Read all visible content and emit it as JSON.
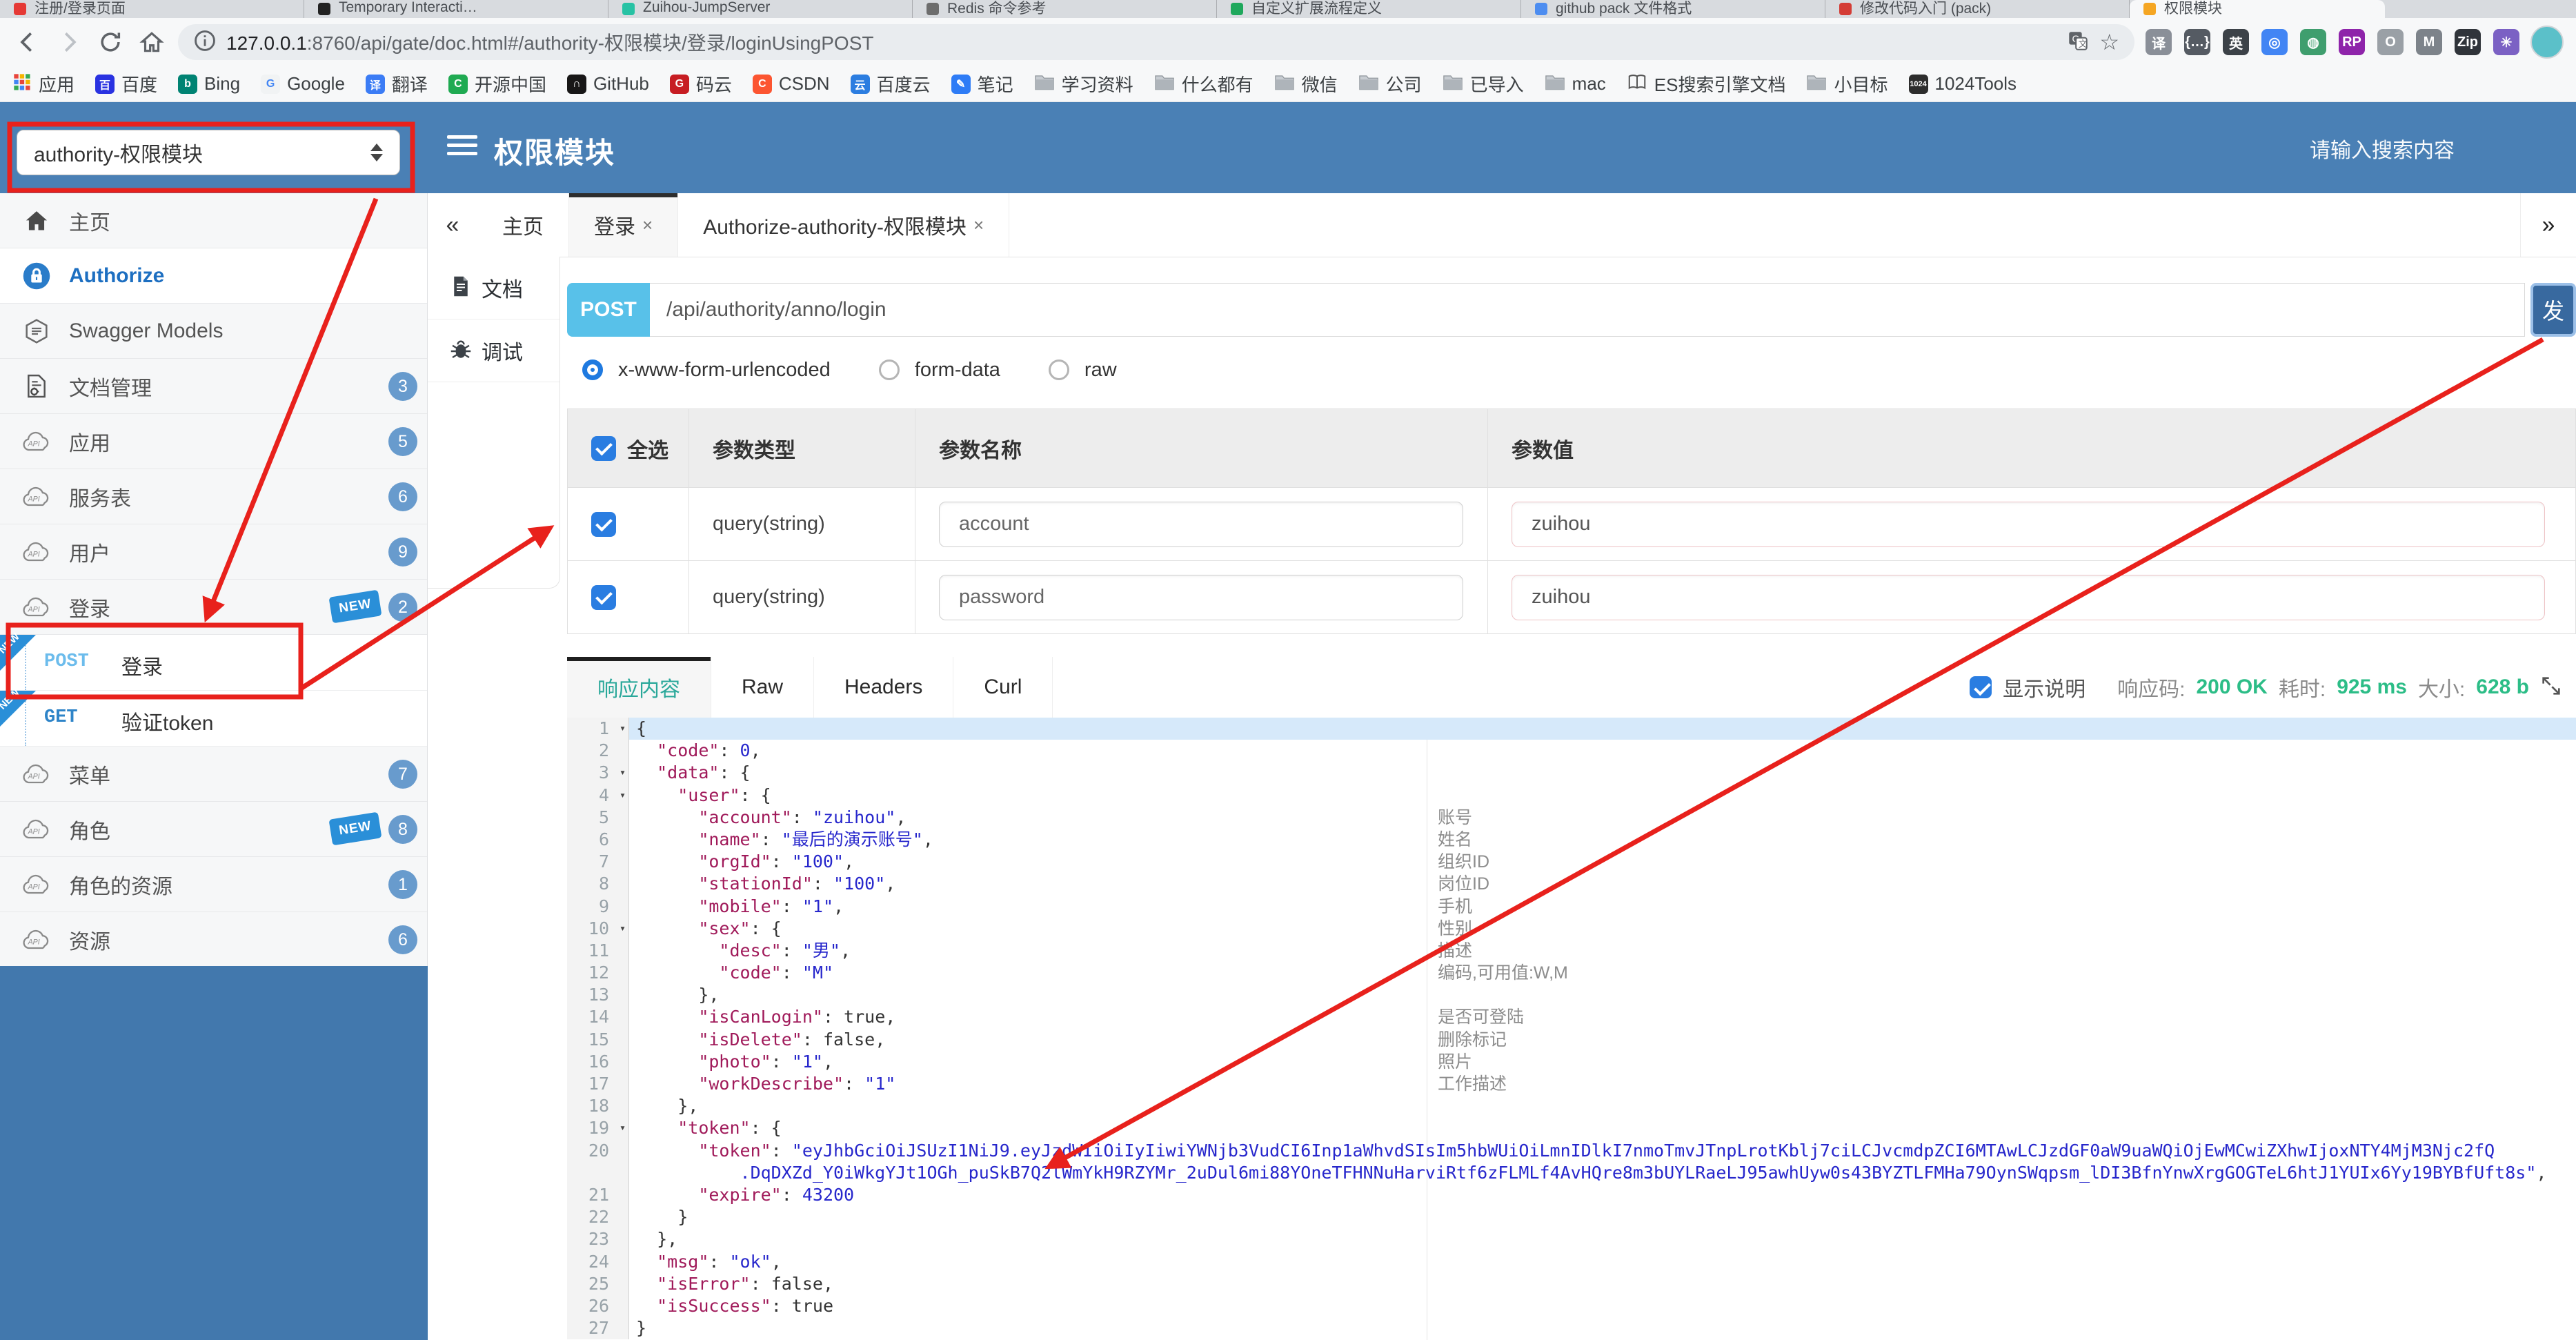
{
  "browser": {
    "tabs": [
      {
        "title": "注册/登录页面",
        "color": "#e53935"
      },
      {
        "title": "Temporary Interacti…",
        "color": "#222222"
      },
      {
        "title": "Zuihou-JumpServer",
        "color": "#27c2a4"
      },
      {
        "title": "Redis 命令参考",
        "color": "#6d6d6d"
      },
      {
        "title": "自定义扩展流程定义",
        "color": "#1fa85c"
      },
      {
        "title": "github pack 文件格式",
        "color": "#4d8df0"
      },
      {
        "title": "修改代码入门 (pack)",
        "color": "#d43c35"
      },
      {
        "title": "权限模块",
        "color": "#f5a623",
        "active": true
      }
    ],
    "url": {
      "host": "127.0.0.1",
      "rest": ":8760/api/gate/doc.html#/authority-权限模块/登录/loginUsingPOST"
    },
    "extensions": [
      {
        "name": "translate-ext-icon",
        "glyph": "译",
        "color": "#8a8f98"
      },
      {
        "name": "json-viewer-ext-icon",
        "glyph": "{…}",
        "color": "#555b63"
      },
      {
        "name": "en-translate-ext-icon",
        "glyph": "英",
        "color": "#3c4248"
      },
      {
        "name": "chrome-ext-icon",
        "glyph": "◎",
        "color": "#4285f4"
      },
      {
        "name": "proxy-globe-ext-icon",
        "glyph": "◍",
        "color": "#3f9e6e"
      },
      {
        "name": "rp-ext-icon",
        "glyph": "RP",
        "color": "#8e24aa"
      },
      {
        "name": "o-ext-icon",
        "glyph": "O",
        "color": "#9aa0a6"
      },
      {
        "name": "shield-ext-icon",
        "glyph": "M",
        "color": "#7d838a"
      },
      {
        "name": "gitzip-ext-icon",
        "glyph": "Zip",
        "color": "#30343a"
      },
      {
        "name": "pinwheel-ext-icon",
        "glyph": "✳",
        "color": "#7b61c4"
      }
    ],
    "bookmarks": [
      {
        "label": "应用",
        "icon": "grid"
      },
      {
        "label": "百度",
        "icon": "badge",
        "color": "#2932e1",
        "glyph": "百"
      },
      {
        "label": "Bing",
        "icon": "badge",
        "color": "#008373",
        "glyph": "b"
      },
      {
        "label": "Google",
        "icon": "badge",
        "color": "#f1f3f4",
        "glyph": "G",
        "glyphColor": "#4285f4"
      },
      {
        "label": "翻译",
        "icon": "badge",
        "color": "#3b7cf5",
        "glyph": "译"
      },
      {
        "label": "开源中国",
        "icon": "badge",
        "color": "#1faa52",
        "glyph": "C"
      },
      {
        "label": "GitHub",
        "icon": "badge",
        "color": "#181717",
        "glyph": "∩"
      },
      {
        "label": "码云",
        "icon": "badge",
        "color": "#c71d23",
        "glyph": "G"
      },
      {
        "label": "CSDN",
        "icon": "badge",
        "color": "#fc5531",
        "glyph": "C"
      },
      {
        "label": "百度云",
        "icon": "badge",
        "color": "#2b7de0",
        "glyph": "云"
      },
      {
        "label": "笔记",
        "icon": "badge",
        "color": "#2e7cf6",
        "glyph": "✎"
      },
      {
        "label": "学习资料",
        "icon": "folder"
      },
      {
        "label": "什么都有",
        "icon": "folder"
      },
      {
        "label": "微信",
        "icon": "folder"
      },
      {
        "label": "公司",
        "icon": "folder"
      },
      {
        "label": "已导入",
        "icon": "folder"
      },
      {
        "label": "mac",
        "icon": "folder"
      },
      {
        "label": "ES搜索引擎文档",
        "icon": "book"
      },
      {
        "label": "小目标",
        "icon": "folder"
      },
      {
        "label": "1024Tools",
        "icon": "badge",
        "color": "#2d2d2d",
        "glyph": "1024"
      }
    ]
  },
  "header": {
    "module_select": "authority-权限模块",
    "title": "权限模块",
    "search_placeholder": "请输入搜索内容"
  },
  "sidebar": {
    "items": [
      {
        "icon": "home",
        "label": "主页"
      },
      {
        "icon": "lock",
        "label": "Authorize",
        "auth": true
      },
      {
        "icon": "swagger",
        "label": "Swagger Models"
      },
      {
        "icon": "docmgr",
        "label": "文档管理",
        "badge": "3"
      },
      {
        "icon": "api",
        "label": "应用",
        "badge": "5"
      },
      {
        "icon": "api",
        "label": "服务表",
        "badge": "6"
      },
      {
        "icon": "api",
        "label": "用户",
        "badge": "9"
      },
      {
        "icon": "api",
        "label": "登录",
        "badge": "2",
        "isNew": true
      },
      {
        "endpoint": true,
        "method": "POST",
        "label": "登录",
        "ribbon": "NEW"
      },
      {
        "endpoint": true,
        "method": "GET",
        "label": "验证token",
        "ribbon": "NEW"
      },
      {
        "icon": "api",
        "label": "菜单",
        "badge": "7"
      },
      {
        "icon": "api",
        "label": "角色",
        "badge": "8",
        "isNew": true
      },
      {
        "icon": "api",
        "label": "角色的资源",
        "badge": "1"
      },
      {
        "icon": "api",
        "label": "资源",
        "badge": "6"
      }
    ],
    "new_label": "NEW"
  },
  "tabsbar": {
    "collapse": "«",
    "more": "»",
    "items": [
      {
        "label": "主页",
        "closable": false
      },
      {
        "label": "登录",
        "closable": true,
        "active": true
      },
      {
        "label": "Authorize-authority-权限模块",
        "closable": true
      }
    ],
    "close_glyph": "×"
  },
  "docnav": [
    {
      "icon": "doc",
      "label": "文档"
    },
    {
      "icon": "bug",
      "label": "调试",
      "active": true
    }
  ],
  "request": {
    "method": "POST",
    "url": "/api/authority/anno/login",
    "send_label": "发",
    "body_types": [
      {
        "label": "x-www-form-urlencoded",
        "selected": true
      },
      {
        "label": "form-data",
        "selected": false
      },
      {
        "label": "raw",
        "selected": false
      }
    ]
  },
  "param_table": {
    "headers": [
      "全选",
      "参数类型",
      "参数名称",
      "参数值"
    ],
    "rows": [
      {
        "checked": true,
        "type": "query(string)",
        "name": "account",
        "value": "zuihou"
      },
      {
        "checked": true,
        "type": "query(string)",
        "name": "password",
        "value": "zuihou"
      }
    ]
  },
  "response": {
    "tabs": [
      "响应内容",
      "Raw",
      "Headers",
      "Curl"
    ],
    "active_tab": "响应内容",
    "show_desc": "显示说明",
    "status_label": "响应码:",
    "status_value": "200 OK",
    "time_label": "耗时:",
    "time_value": "925 ms",
    "size_label": "大小:",
    "size_value": "628 b"
  },
  "code": {
    "rows": [
      {
        "num": "1",
        "fold": true,
        "hl": true,
        "ind": 0,
        "segs": [
          [
            "p",
            "{"
          ]
        ],
        "note": ""
      },
      {
        "num": "2",
        "ind": 2,
        "segs": [
          [
            "k",
            "\"code\""
          ],
          [
            "p",
            ": "
          ],
          [
            "n",
            "0"
          ],
          [
            "p",
            ","
          ]
        ],
        "note": ""
      },
      {
        "num": "3",
        "fold": true,
        "ind": 2,
        "segs": [
          [
            "k",
            "\"data\""
          ],
          [
            "p",
            ": {"
          ]
        ],
        "note": ""
      },
      {
        "num": "4",
        "fold": true,
        "ind": 4,
        "segs": [
          [
            "k",
            "\"user\""
          ],
          [
            "p",
            ": {"
          ]
        ],
        "note": ""
      },
      {
        "num": "5",
        "ind": 6,
        "segs": [
          [
            "k",
            "\"account\""
          ],
          [
            "p",
            ": "
          ],
          [
            "s",
            "\"zuihou\""
          ],
          [
            "p",
            ","
          ]
        ],
        "note": "账号"
      },
      {
        "num": "6",
        "ind": 6,
        "segs": [
          [
            "k",
            "\"name\""
          ],
          [
            "p",
            ": "
          ],
          [
            "s",
            "\"最后的演示账号\""
          ],
          [
            "p",
            ","
          ]
        ],
        "note": "姓名"
      },
      {
        "num": "7",
        "ind": 6,
        "segs": [
          [
            "k",
            "\"orgId\""
          ],
          [
            "p",
            ": "
          ],
          [
            "s",
            "\"100\""
          ],
          [
            "p",
            ","
          ]
        ],
        "note": "组织ID"
      },
      {
        "num": "8",
        "ind": 6,
        "segs": [
          [
            "k",
            "\"stationId\""
          ],
          [
            "p",
            ": "
          ],
          [
            "s",
            "\"100\""
          ],
          [
            "p",
            ","
          ]
        ],
        "note": "岗位ID"
      },
      {
        "num": "9",
        "ind": 6,
        "segs": [
          [
            "k",
            "\"mobile\""
          ],
          [
            "p",
            ": "
          ],
          [
            "s",
            "\"1\""
          ],
          [
            "p",
            ","
          ]
        ],
        "note": "手机"
      },
      {
        "num": "10",
        "fold": true,
        "ind": 6,
        "segs": [
          [
            "k",
            "\"sex\""
          ],
          [
            "p",
            ": {"
          ]
        ],
        "note": "性别"
      },
      {
        "num": "11",
        "ind": 8,
        "segs": [
          [
            "k",
            "\"desc\""
          ],
          [
            "p",
            ": "
          ],
          [
            "s",
            "\"男\""
          ],
          [
            "p",
            ","
          ]
        ],
        "note": "描述"
      },
      {
        "num": "12",
        "ind": 8,
        "segs": [
          [
            "k",
            "\"code\""
          ],
          [
            "p",
            ": "
          ],
          [
            "s",
            "\"M\""
          ]
        ],
        "note": "编码,可用值:W,M"
      },
      {
        "num": "13",
        "ind": 6,
        "segs": [
          [
            "p",
            "},"
          ]
        ],
        "note": ""
      },
      {
        "num": "14",
        "ind": 6,
        "segs": [
          [
            "k",
            "\"isCanLogin\""
          ],
          [
            "p",
            ": "
          ],
          [
            "b",
            "true"
          ],
          [
            "p",
            ","
          ]
        ],
        "note": "是否可登陆"
      },
      {
        "num": "15",
        "ind": 6,
        "segs": [
          [
            "k",
            "\"isDelete\""
          ],
          [
            "p",
            ": "
          ],
          [
            "b",
            "false"
          ],
          [
            "p",
            ","
          ]
        ],
        "note": "删除标记"
      },
      {
        "num": "16",
        "ind": 6,
        "segs": [
          [
            "k",
            "\"photo\""
          ],
          [
            "p",
            ": "
          ],
          [
            "s",
            "\"1\""
          ],
          [
            "p",
            ","
          ]
        ],
        "note": "照片"
      },
      {
        "num": "17",
        "ind": 6,
        "segs": [
          [
            "k",
            "\"workDescribe\""
          ],
          [
            "p",
            ": "
          ],
          [
            "s",
            "\"1\""
          ]
        ],
        "note": "工作描述"
      },
      {
        "num": "18",
        "ind": 4,
        "segs": [
          [
            "p",
            "},"
          ]
        ],
        "note": ""
      },
      {
        "num": "19",
        "fold": true,
        "ind": 4,
        "segs": [
          [
            "k",
            "\"token\""
          ],
          [
            "p",
            ": {"
          ]
        ],
        "note": ""
      },
      {
        "num": "20",
        "ind": 6,
        "segs": [
          [
            "k",
            "\"token\""
          ],
          [
            "p",
            ": "
          ],
          [
            "s",
            "\"eyJhbGciOiJSUzI1NiJ9.eyJzdWIiOiIyIiwiYWNjb3VudCI6Inp1aWhvdSIsIm5hbWUiOiLmnIDlkI7nmoTmvJTnpLrotKblj7ciLCJvcmdpZCI6MTAwLCJzdGF0aW9uaWQiOjEwMCwiZXhwIjoxNTY4MjM3Njc2fQ"
          ]
        ],
        "note": ""
      },
      {
        "num": "",
        "ind": 10,
        "segs": [
          [
            "s",
            ".DqDXZd_Y0iWkgYJt1OGh_puSkB7Q2lWmYkH9RZYMr_2uDul6mi88YOneTFHNNuHarviRtf6zFLMLf4AvHQre8m3bUYLRaeLJ95awhUyw0s43BYZTLFMHa79OynSWqpsm_lDI3BfnYnwXrgGOGTeL6htJ1YUIx6Yy19BYBfUft8s\""
          ],
          [
            "p",
            ","
          ]
        ],
        "note": ""
      },
      {
        "num": "21",
        "ind": 6,
        "segs": [
          [
            "k",
            "\"expire\""
          ],
          [
            "p",
            ": "
          ],
          [
            "n",
            "43200"
          ]
        ],
        "note": ""
      },
      {
        "num": "22",
        "ind": 4,
        "segs": [
          [
            "p",
            "}"
          ]
        ],
        "note": ""
      },
      {
        "num": "23",
        "ind": 2,
        "segs": [
          [
            "p",
            "},"
          ]
        ],
        "note": ""
      },
      {
        "num": "24",
        "ind": 2,
        "segs": [
          [
            "k",
            "\"msg\""
          ],
          [
            "p",
            ": "
          ],
          [
            "s",
            "\"ok\""
          ],
          [
            "p",
            ","
          ]
        ],
        "note": ""
      },
      {
        "num": "25",
        "ind": 2,
        "segs": [
          [
            "k",
            "\"isError\""
          ],
          [
            "p",
            ": "
          ],
          [
            "b",
            "false"
          ],
          [
            "p",
            ","
          ]
        ],
        "note": ""
      },
      {
        "num": "26",
        "ind": 2,
        "segs": [
          [
            "k",
            "\"isSuccess\""
          ],
          [
            "p",
            ": "
          ],
          [
            "b",
            "true"
          ]
        ],
        "note": ""
      },
      {
        "num": "27",
        "ind": 0,
        "segs": [
          [
            "p",
            "}"
          ]
        ],
        "note": ""
      }
    ]
  },
  "colors": {
    "header_blue": "#4a80b5",
    "sidebar_blue": "#4278ad",
    "post_badge": "#58c1e9",
    "send_button": "#38699f",
    "annotation_red": "#e8211c",
    "status_green": "#2cbd87",
    "active_resp_tab_text": "#2aa89a",
    "line_highlight": "#d6e9fa"
  }
}
